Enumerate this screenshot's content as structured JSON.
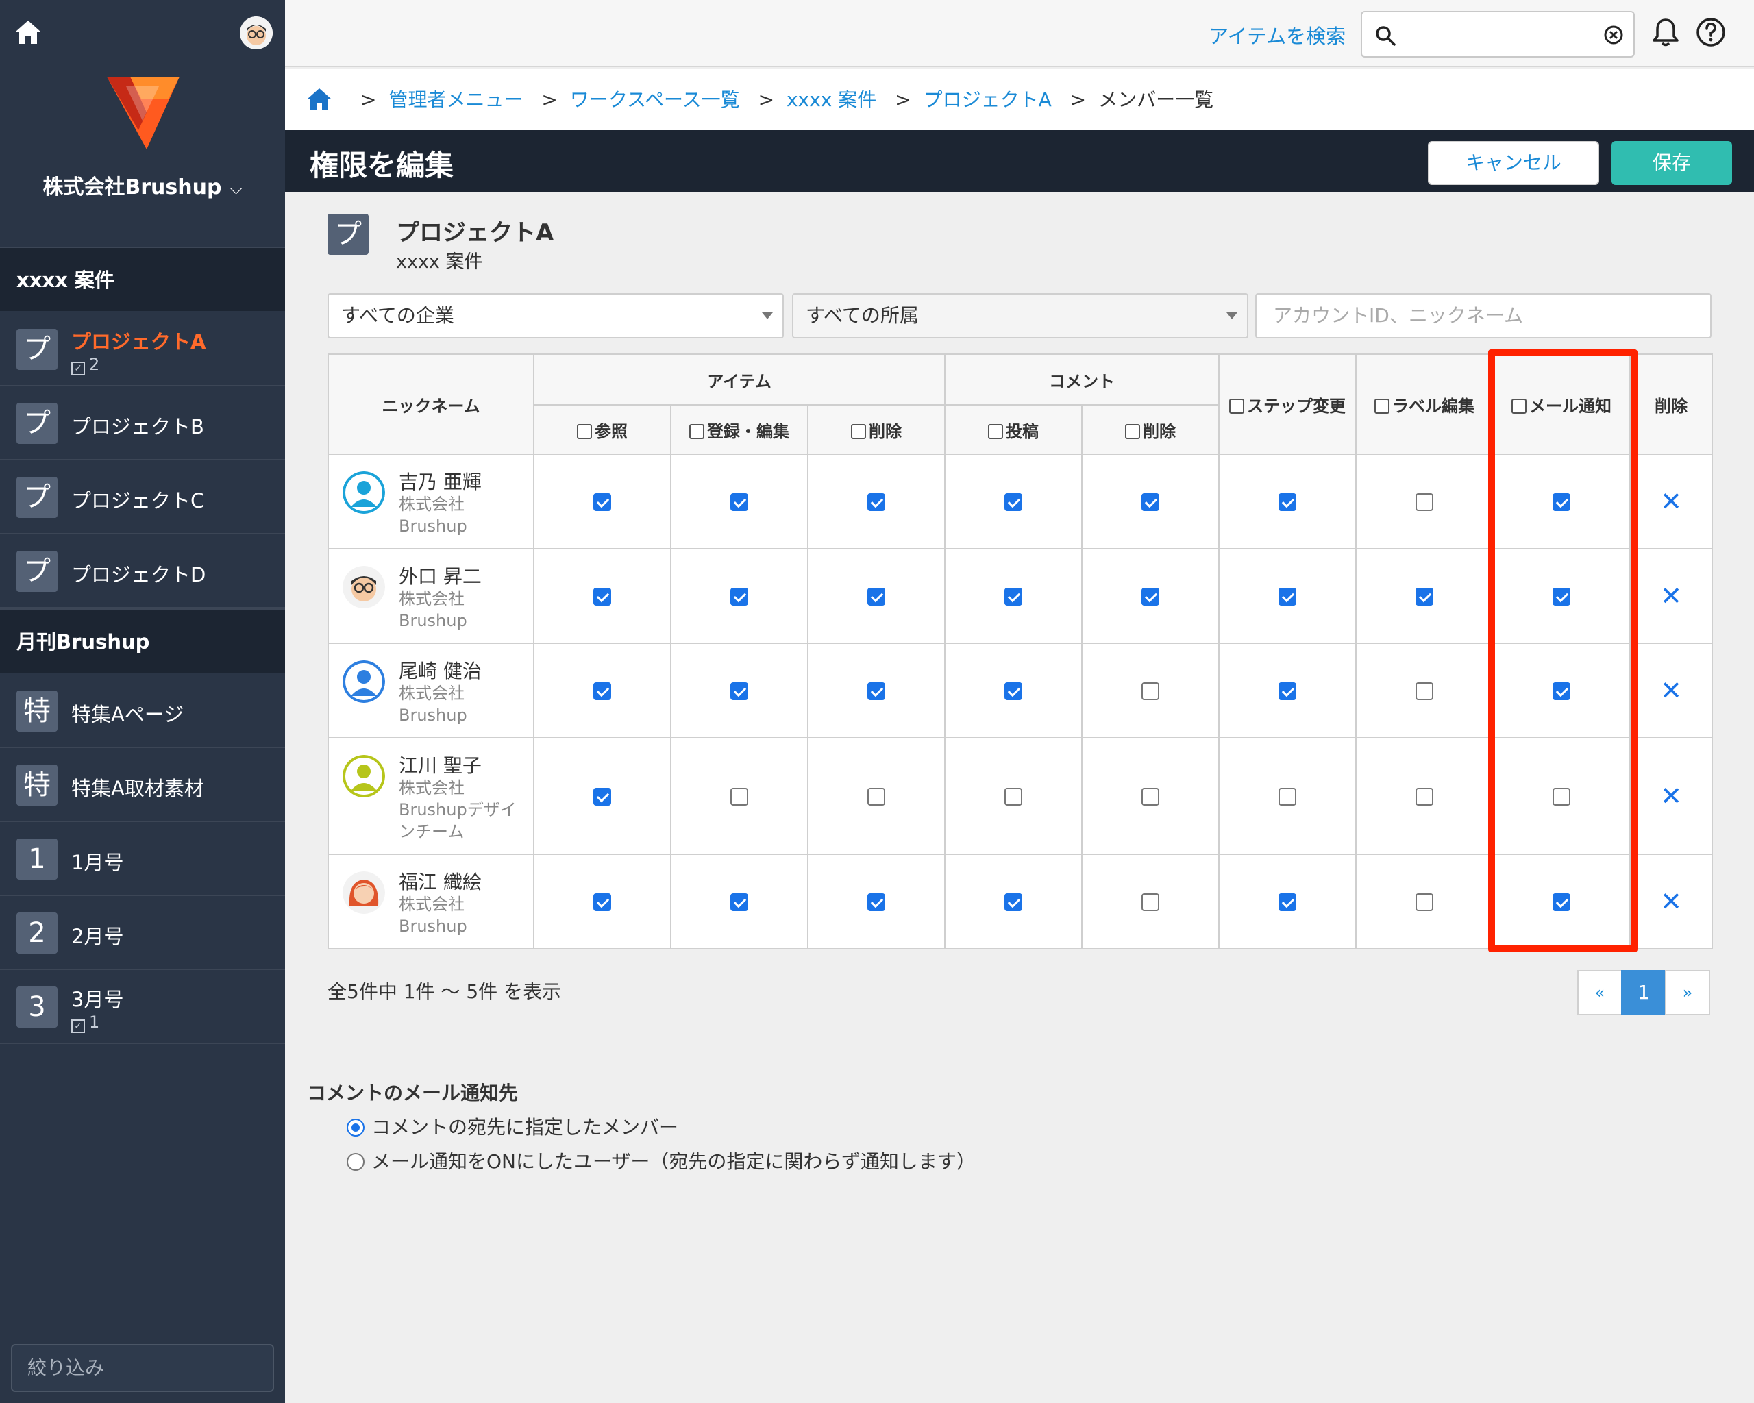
{
  "sidebar": {
    "company": "株式会社Brushup",
    "groups": [
      {
        "label": "xxxx 案件"
      },
      {
        "label": "月刊Brushup"
      }
    ],
    "items": [
      {
        "icon": "プ",
        "label": "プロジェクトA",
        "count": "2",
        "active": true
      },
      {
        "icon": "プ",
        "label": "プロジェクトB"
      },
      {
        "icon": "プ",
        "label": "プロジェクトC"
      },
      {
        "icon": "プ",
        "label": "プロジェクトD"
      },
      {
        "icon": "特",
        "label": "特集Aページ"
      },
      {
        "icon": "特",
        "label": "特集A取材素材"
      },
      {
        "icon": "1",
        "label": "1月号"
      },
      {
        "icon": "2",
        "label": "2月号"
      },
      {
        "icon": "3",
        "label": "3月号",
        "count": "1"
      }
    ],
    "filter_placeholder": "絞り込み"
  },
  "header": {
    "search_link": "アイテムを検索",
    "search_value": ""
  },
  "breadcrumb": [
    "管理者メニュー",
    "ワークスペース一覧",
    "xxxx 案件",
    "プロジェクトA",
    "メンバー一覧"
  ],
  "page": {
    "title": "権限を編集",
    "cancel": "キャンセル",
    "save": "保存"
  },
  "project": {
    "icon": "プ",
    "name": "プロジェクトA",
    "parent": "xxxx 案件"
  },
  "filters": {
    "company": "すべての企業",
    "dept": "すべての所属",
    "search_placeholder": "アカウントID、ニックネーム"
  },
  "table": {
    "headers": {
      "nickname": "ニックネーム",
      "item": "アイテム",
      "comment": "コメント",
      "step": "ステップ変更",
      "label": "ラベル編集",
      "mail": "メール通知",
      "delete": "削除",
      "view": "参照",
      "register": "登録・編集",
      "item_delete": "削除",
      "post": "投稿",
      "comment_delete": "削除"
    },
    "rows": [
      {
        "name": "吉乃 亜輝",
        "company": "株式会社Brushup",
        "avatar": "cyan",
        "perms": [
          true,
          true,
          true,
          true,
          true,
          true,
          false,
          true
        ]
      },
      {
        "name": "外口 昇二",
        "company": "株式会社Brushup",
        "avatar": "face",
        "perms": [
          true,
          true,
          true,
          true,
          true,
          true,
          true,
          true
        ]
      },
      {
        "name": "尾崎 健治",
        "company": "株式会社Brushup",
        "avatar": "blue",
        "perms": [
          true,
          true,
          true,
          true,
          false,
          true,
          false,
          true
        ]
      },
      {
        "name": "江川 聖子",
        "company": "株式会社Brushupデザインチーム",
        "avatar": "lime",
        "perms": [
          true,
          false,
          false,
          false,
          false,
          false,
          false,
          false
        ]
      },
      {
        "name": "福江 織絵",
        "company": "株式会社Brushup",
        "avatar": "woman",
        "perms": [
          true,
          true,
          true,
          true,
          false,
          true,
          false,
          true
        ]
      }
    ]
  },
  "pagination": {
    "summary": "全5件中 1件 〜 5件 を表示",
    "prev": "«",
    "current": "1",
    "next": "»"
  },
  "mail_target": {
    "title": "コメントのメール通知先",
    "options": [
      {
        "label": "コメントの宛先に指定したメンバー",
        "selected": true
      },
      {
        "label": "メール通知をONにしたユーザー（宛先の指定に関わらず通知します）",
        "selected": false
      }
    ]
  },
  "colors": {
    "accent": "#1a8ad6",
    "save": "#30bdb0",
    "highlight": "#ff2200",
    "sidebar": "#2a3546",
    "active_item": "#ff6a2b"
  }
}
